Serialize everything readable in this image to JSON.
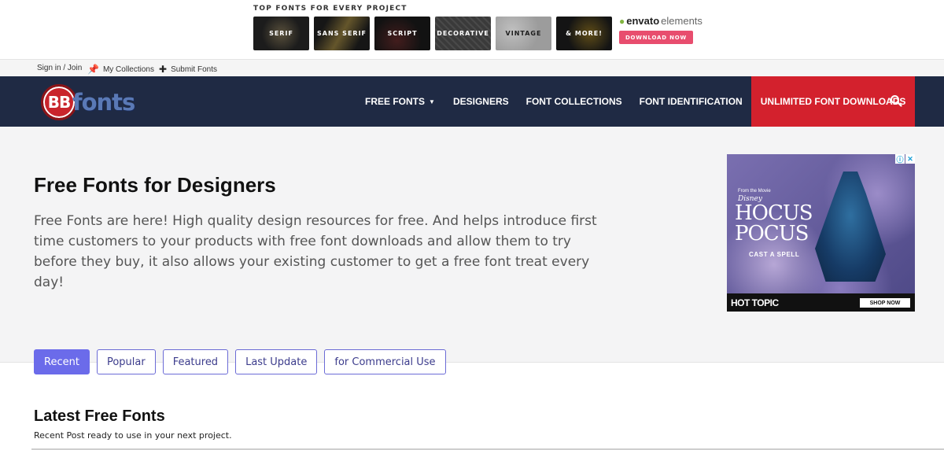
{
  "promo": {
    "title": "TOP FONTS FOR EVERY PROJECT",
    "tiles": [
      "SERIF",
      "SANS SERIF",
      "SCRIPT",
      "DECORATIVE",
      "VINTAGE",
      "& MORE!"
    ],
    "envato_brand": "envato",
    "envato_suffix": "elements",
    "download_label": "DOWNLOAD NOW"
  },
  "utility": {
    "signin": "Sign in / Join",
    "collections": "My Collections",
    "submit": "Submit Fonts"
  },
  "brand": {
    "logo_badge": "BB",
    "logo_text": "fonts"
  },
  "nav": {
    "items": [
      "FREE FONTS",
      "DESIGNERS",
      "FONT COLLECTIONS",
      "FONT IDENTIFICATION"
    ],
    "cta": "UNLIMITED FONT DOWNLOADS",
    "colors": {
      "bar": "#1f2a44",
      "cta": "#d3212d"
    }
  },
  "hero": {
    "title": "Free Fonts for Designers",
    "description": "Free Fonts are here! High quality design resources for free. And helps introduce first time customers to your products with free font downloads and allow them to try before they buy, it also allows your existing customer to get a free font treat every day!"
  },
  "ad": {
    "tagline": "From the Movie",
    "studio": "Disney",
    "title": "HOCUS POCUS",
    "subtitle": "CAST A SPELL",
    "brand": "HOT TOPIC",
    "cta": "SHOP NOW"
  },
  "tabs": [
    {
      "label": "Recent",
      "active": true
    },
    {
      "label": "Popular",
      "active": false
    },
    {
      "label": "Featured",
      "active": false
    },
    {
      "label": "Last Update",
      "active": false
    },
    {
      "label": "for Commercial Use",
      "active": false
    }
  ],
  "latest": {
    "title": "Latest Free Fonts",
    "subtitle": "Recent Post ready to use in your next project."
  }
}
